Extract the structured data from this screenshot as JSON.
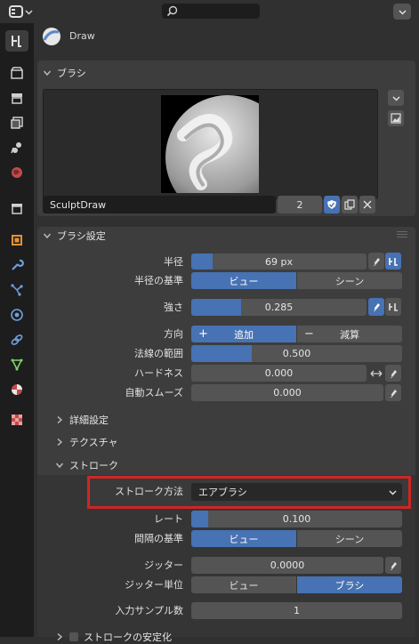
{
  "header": {
    "object_name": "Draw",
    "search_placeholder": ""
  },
  "brush_panel": {
    "title": "ブラシ",
    "brush_name": "SculptDraw",
    "user_count": "2"
  },
  "brush_settings": {
    "title": "ブラシ設定",
    "radius": {
      "label": "半径",
      "value": "69 px",
      "fill": 0.12
    },
    "radius_unit": {
      "label": "半径の基準",
      "options": [
        "ビュー",
        "シーン"
      ],
      "selected": 0
    },
    "strength": {
      "label": "強さ",
      "value": "0.285",
      "fill": 0.285
    },
    "direction": {
      "label": "方向",
      "options": [
        "追加",
        "減算"
      ],
      "option_signs": [
        "+",
        "−"
      ],
      "selected": 0
    },
    "normal_radius": {
      "label": "法線の範囲",
      "value": "0.500",
      "fill": 0.285
    },
    "hardness": {
      "label": "ハードネス",
      "value": "0.000",
      "fill": 0
    },
    "auto_smooth": {
      "label": "自動スムーズ",
      "value": "0.000",
      "fill": 0
    }
  },
  "subpanels": {
    "advanced": "詳細設定",
    "texture": "テクスチャ",
    "stroke": "ストローク",
    "stabilize": "ストロークの安定化"
  },
  "stroke": {
    "method": {
      "label": "ストローク方法",
      "value": "エアブラシ"
    },
    "rate": {
      "label": "レート",
      "value": "0.100",
      "fill": 0.08
    },
    "spacing_unit": {
      "label": "間隔の基準",
      "options": [
        "ビュー",
        "シーン"
      ],
      "selected": 0
    },
    "jitter": {
      "label": "ジッター",
      "value": "0.0000"
    },
    "jitter_unit": {
      "label": "ジッター単位",
      "options": [
        "ビュー",
        "ブラシ"
      ],
      "selected": 1
    },
    "input_samples": {
      "label": "入力サンプル数",
      "value": "1"
    }
  },
  "colors": {
    "accent": "#4772b3",
    "highlight_box": "#d32424",
    "field": "#545454",
    "panel": "#3d3d3d"
  }
}
